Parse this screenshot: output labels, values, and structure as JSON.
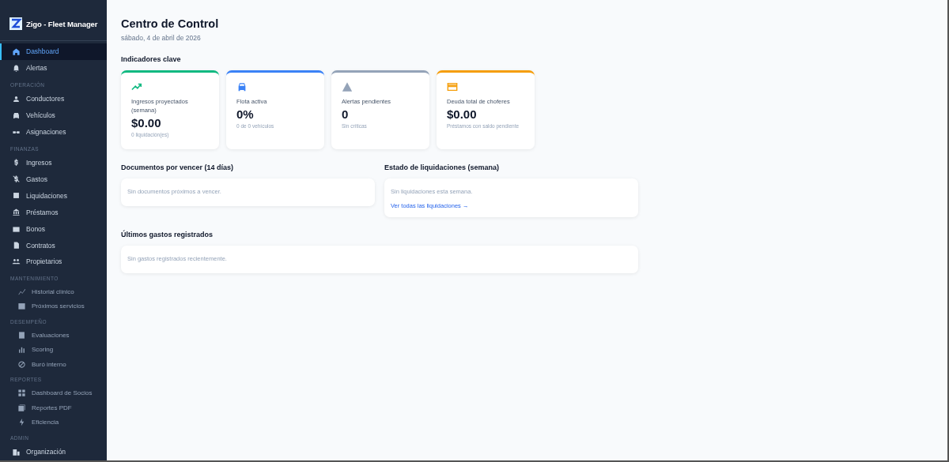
{
  "brand": {
    "title": "Zigo - Fleet Manager"
  },
  "sidebar": {
    "groups": [
      {
        "items": [
          {
            "label": "Dashboard",
            "kind": "main",
            "selected": true
          },
          {
            "label": "Alertas",
            "kind": "main",
            "selected": false
          }
        ]
      },
      {
        "heading": "OPERACIÓN",
        "items": [
          {
            "label": "Conductores",
            "kind": "main",
            "selected": false
          },
          {
            "label": "Vehículos",
            "kind": "main",
            "selected": false
          },
          {
            "label": "Asignaciones",
            "kind": "main",
            "selected": false
          }
        ]
      },
      {
        "heading": "FINANZAS",
        "items": [
          {
            "label": "Ingresos",
            "kind": "main",
            "selected": false
          },
          {
            "label": "Gastos",
            "kind": "main",
            "selected": false
          },
          {
            "label": "Liquidaciones",
            "kind": "main",
            "selected": false
          },
          {
            "label": "Préstamos",
            "kind": "main",
            "selected": false
          },
          {
            "label": "Bonos",
            "kind": "main",
            "selected": false
          },
          {
            "label": "Contratos",
            "kind": "main",
            "selected": false
          },
          {
            "label": "Propietarios",
            "kind": "main",
            "selected": false
          }
        ]
      },
      {
        "heading": "MANTENIMIENTO",
        "items": [
          {
            "label": "Historial clínico",
            "kind": "sub",
            "selected": false
          },
          {
            "label": "Próximos servicios",
            "kind": "sub",
            "selected": false
          }
        ]
      },
      {
        "heading": "DESEMPEÑO",
        "items": [
          {
            "label": "Evaluaciones",
            "kind": "sub",
            "selected": false
          },
          {
            "label": "Scoring",
            "kind": "sub",
            "selected": false
          },
          {
            "label": "Buró interno",
            "kind": "sub",
            "selected": false
          }
        ]
      },
      {
        "heading": "REPORTES",
        "items": [
          {
            "label": "Dashboard de Socios",
            "kind": "sub",
            "selected": false
          },
          {
            "label": "Reportes PDF",
            "kind": "sub",
            "selected": false
          },
          {
            "label": "Eficiencia",
            "kind": "sub",
            "selected": false
          }
        ]
      },
      {
        "heading": "ADMIN",
        "items": [
          {
            "label": "Organización",
            "kind": "main",
            "selected": false
          }
        ]
      }
    ]
  },
  "page": {
    "title": "Centro de Control",
    "date": "sábado, 4 de abril de 2026"
  },
  "kpis": {
    "heading": "Indicadores clave",
    "cards": [
      {
        "label": "Ingresos proyectados (semana)",
        "value": "$0.00",
        "note": "0 liquidación(es)",
        "color": "#10b981"
      },
      {
        "label": "Flota activa",
        "value": "0%",
        "note": "0 de 0 vehículos",
        "color": "#3b82f6"
      },
      {
        "label": "Alertas pendientes",
        "value": "0",
        "note": "Sin críticas",
        "color": "#94a3b8"
      },
      {
        "label": "Deuda total de choferes",
        "value": "$0.00",
        "note": "Préstamos con saldo pendiente",
        "color": "#f59e0b"
      }
    ]
  },
  "documents": {
    "heading": "Documentos por vencer (14 días)",
    "empty": "Sin documentos próximos a vencer."
  },
  "settlements": {
    "heading": "Estado de liquidaciones (semana)",
    "empty": "Sin liquidaciones esta semana.",
    "link": "Ver todas las liquidaciones →"
  },
  "expenses": {
    "heading": "Últimos gastos registrados",
    "empty": "Sin gastos registrados recientemente."
  }
}
